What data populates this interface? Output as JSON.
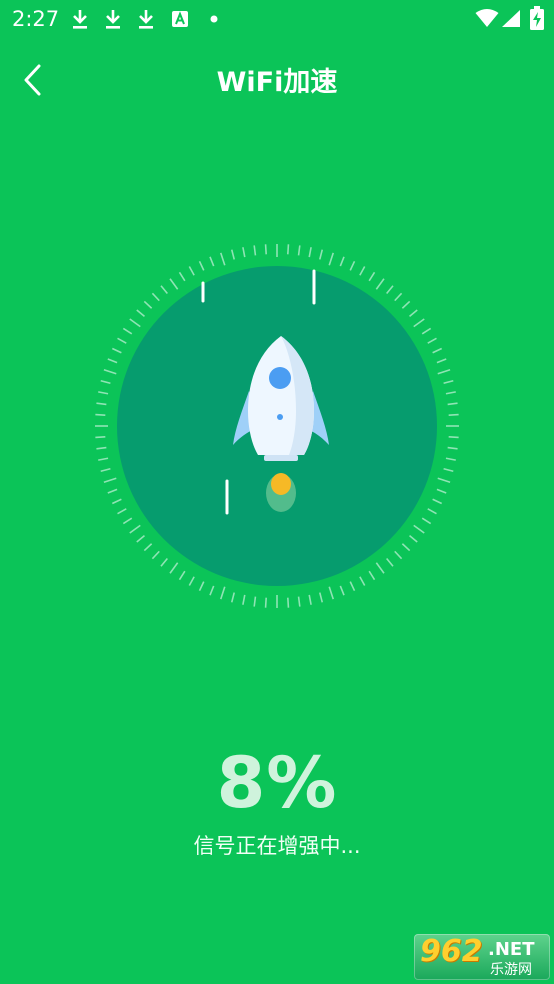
{
  "status_bar": {
    "time": "2:27",
    "notification_icons": [
      "download-icon",
      "download-icon",
      "download-icon",
      "a-box-icon",
      "dot-icon"
    ],
    "system_icons": [
      "wifi-icon",
      "signal-icon",
      "battery-charging-icon"
    ]
  },
  "header": {
    "title": "WiFi加速",
    "back_icon": "chevron-left-icon"
  },
  "accelerator": {
    "icon": "rocket-icon",
    "progress_percent": 8,
    "percent_label": "8%",
    "status_text": "信号正在增强中..."
  },
  "watermark": {
    "logo": "962",
    "net": ".NET",
    "sub": "乐游网"
  },
  "colors": {
    "background": "#0bc458",
    "inner_circle": "#069c6e",
    "rocket_body": "#eef7ff",
    "rocket_window": "#4b9df2",
    "flame": "#f6b926"
  }
}
